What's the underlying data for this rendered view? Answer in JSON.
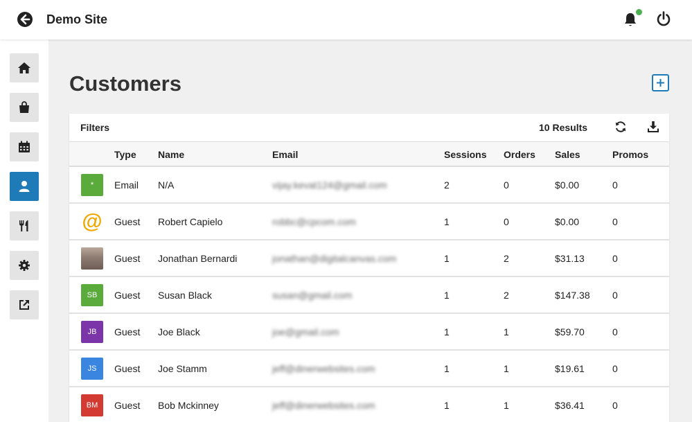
{
  "header": {
    "title": "Demo Site"
  },
  "sidebar": {
    "items": [
      {
        "label": "home",
        "icon": "home-icon"
      },
      {
        "label": "orders",
        "icon": "shopping-bag-icon"
      },
      {
        "label": "calendar",
        "icon": "calendar-icon"
      },
      {
        "label": "customers",
        "icon": "user-icon",
        "active": true
      },
      {
        "label": "menu",
        "icon": "utensils-icon"
      },
      {
        "label": "settings",
        "icon": "gear-icon"
      },
      {
        "label": "external",
        "icon": "external-link-icon"
      }
    ]
  },
  "page": {
    "title": "Customers"
  },
  "toolbar": {
    "filters_label": "Filters",
    "results_label": "10 Results"
  },
  "table": {
    "columns": [
      "Type",
      "Name",
      "Email",
      "Sessions",
      "Orders",
      "Sales",
      "Promos"
    ],
    "rows": [
      {
        "avatar": "*",
        "avatar_color": "#5aab3c",
        "type": "Email",
        "name": "N/A",
        "email": "vijay.kevat124@gmail.com",
        "sessions": "2",
        "orders": "0",
        "sales": "$0.00",
        "promos": "0"
      },
      {
        "avatar": "@",
        "avatar_color": "#ffffff",
        "type": "Guest",
        "name": "Robert Capielo",
        "email": "robbc@cpcom.com",
        "sessions": "1",
        "orders": "0",
        "sales": "$0.00",
        "promos": "0"
      },
      {
        "avatar": "",
        "avatar_color": "#9a8a80",
        "type": "Guest",
        "name": "Jonathan Bernardi",
        "email": "jonathan@digitalcanvas.com",
        "sessions": "1",
        "orders": "2",
        "sales": "$31.13",
        "promos": "0"
      },
      {
        "avatar": "SB",
        "avatar_color": "#5aab3c",
        "type": "Guest",
        "name": "Susan Black",
        "email": "susan@gmail.com",
        "sessions": "1",
        "orders": "2",
        "sales": "$147.38",
        "promos": "0"
      },
      {
        "avatar": "JB",
        "avatar_color": "#7b35a8",
        "type": "Guest",
        "name": "Joe Black",
        "email": "joe@gmail.com",
        "sessions": "1",
        "orders": "1",
        "sales": "$59.70",
        "promos": "0"
      },
      {
        "avatar": "JS",
        "avatar_color": "#3a85e0",
        "type": "Guest",
        "name": "Joe Stamm",
        "email": "jeff@dinerwebsites.com",
        "sessions": "1",
        "orders": "1",
        "sales": "$19.61",
        "promos": "0"
      },
      {
        "avatar": "BM",
        "avatar_color": "#d23a32",
        "type": "Guest",
        "name": "Bob Mckinney",
        "email": "jeff@dinerwebsites.com",
        "sessions": "1",
        "orders": "1",
        "sales": "$36.41",
        "promos": "0"
      }
    ]
  },
  "colors": {
    "accent": "#1e7bb8",
    "status_dot": "#4caf50"
  }
}
